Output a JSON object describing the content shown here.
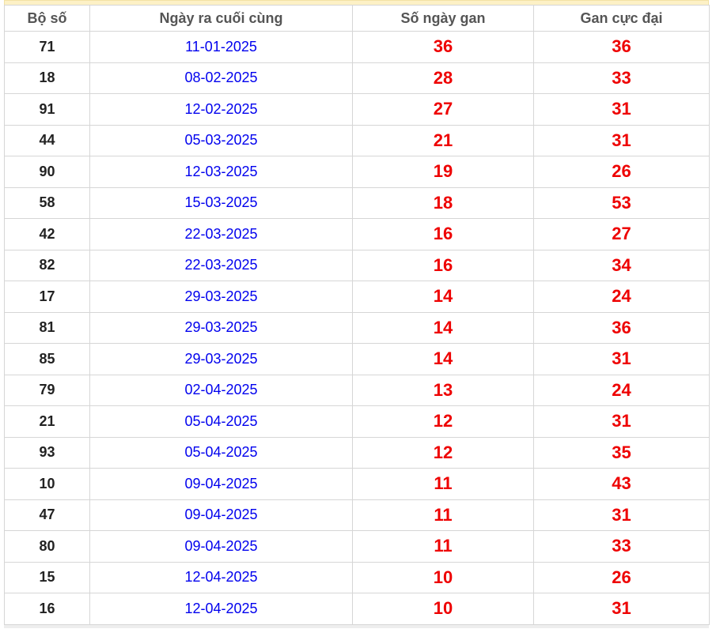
{
  "table": {
    "headers": [
      "Bộ số",
      "Ngày ra cuối cùng",
      "Số ngày gan",
      "Gan cực đại"
    ],
    "rows": [
      [
        "71",
        "11-01-2025",
        "36",
        "36"
      ],
      [
        "18",
        "08-02-2025",
        "28",
        "33"
      ],
      [
        "91",
        "12-02-2025",
        "27",
        "31"
      ],
      [
        "44",
        "05-03-2025",
        "21",
        "31"
      ],
      [
        "90",
        "12-03-2025",
        "19",
        "26"
      ],
      [
        "58",
        "15-03-2025",
        "18",
        "53"
      ],
      [
        "42",
        "22-03-2025",
        "16",
        "27"
      ],
      [
        "82",
        "22-03-2025",
        "16",
        "34"
      ],
      [
        "17",
        "29-03-2025",
        "14",
        "24"
      ],
      [
        "81",
        "29-03-2025",
        "14",
        "36"
      ],
      [
        "85",
        "29-03-2025",
        "14",
        "31"
      ],
      [
        "79",
        "02-04-2025",
        "13",
        "24"
      ],
      [
        "21",
        "05-04-2025",
        "12",
        "31"
      ],
      [
        "93",
        "05-04-2025",
        "12",
        "35"
      ],
      [
        "10",
        "09-04-2025",
        "11",
        "43"
      ],
      [
        "47",
        "09-04-2025",
        "11",
        "31"
      ],
      [
        "80",
        "09-04-2025",
        "11",
        "33"
      ],
      [
        "15",
        "12-04-2025",
        "10",
        "26"
      ],
      [
        "16",
        "12-04-2025",
        "10",
        "31"
      ]
    ]
  },
  "colors": {
    "header_text": "#555555",
    "number_text": "#222222",
    "date_text": "#0000ee",
    "gan_text": "#ee0000",
    "top_bar": "#fdf1c6",
    "border": "#d6d6d6"
  }
}
